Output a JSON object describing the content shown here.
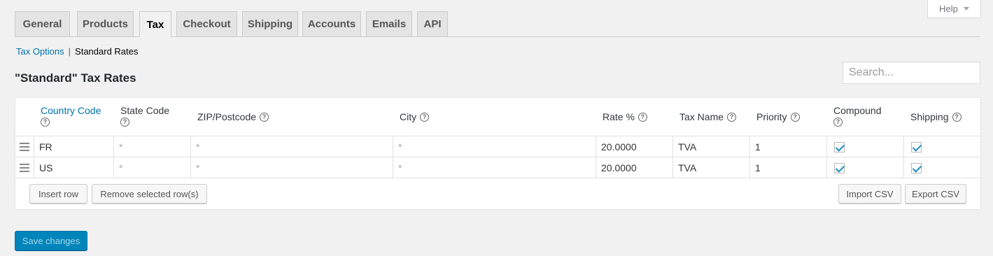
{
  "help": {
    "label": "Help"
  },
  "tabs": [
    {
      "label": "General"
    },
    {
      "label": "Products"
    },
    {
      "label": "Tax"
    },
    {
      "label": "Checkout"
    },
    {
      "label": "Shipping"
    },
    {
      "label": "Accounts"
    },
    {
      "label": "Emails"
    },
    {
      "label": "API"
    }
  ],
  "active_tab": "Tax",
  "subnav": {
    "link": "Tax Options",
    "separator": "|",
    "current": "Standard Rates"
  },
  "page_title": "\"Standard\" Tax Rates",
  "search": {
    "placeholder": "Search...",
    "value": ""
  },
  "columns": {
    "country": "Country Code",
    "state": "State Code",
    "zip": "ZIP/Postcode",
    "city": "City",
    "rate": "Rate %",
    "tax_name": "Tax Name",
    "priority": "Priority",
    "compound": "Compound",
    "shipping": "Shipping"
  },
  "rows": [
    {
      "country": "FR",
      "state": "*",
      "zip": "*",
      "city": "*",
      "rate": "20.0000",
      "tax_name": "TVA",
      "priority": "1",
      "compound": true,
      "shipping": true
    },
    {
      "country": "US",
      "state": "*",
      "zip": "*",
      "city": "*",
      "rate": "20.0000",
      "tax_name": "TVA",
      "priority": "1",
      "compound": true,
      "shipping": true
    }
  ],
  "buttons": {
    "insert_row": "Insert row",
    "remove_rows": "Remove selected row(s)",
    "import_csv": "Import CSV",
    "export_csv": "Export CSV",
    "save": "Save changes"
  },
  "colors": {
    "link": "#0073aa",
    "primary_button": "#0085ba"
  }
}
